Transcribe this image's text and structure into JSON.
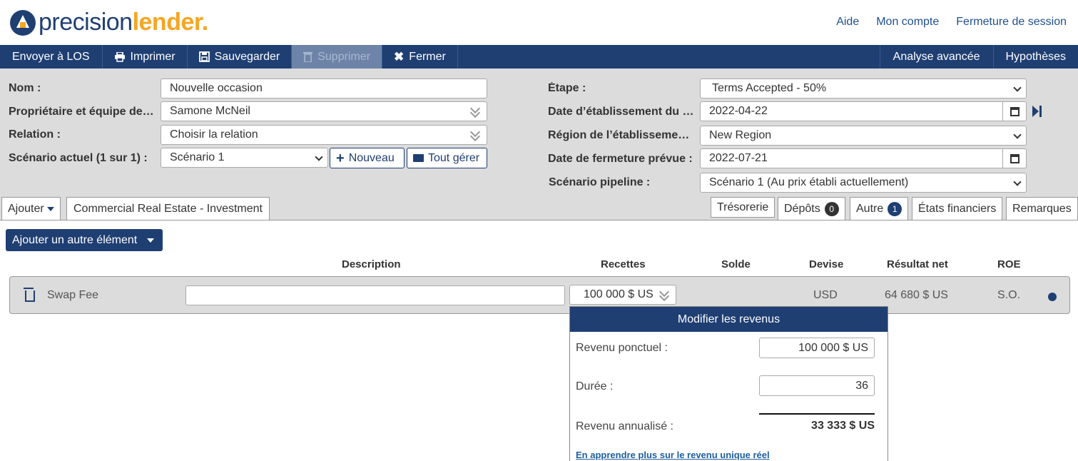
{
  "header": {
    "logo_part1": "precision",
    "logo_part2": "lender",
    "logo_dot": ".",
    "links": [
      "Aide",
      "Mon compte",
      "Fermeture de session"
    ]
  },
  "toolbar": {
    "send_los": "Envoyer à LOS",
    "print": "Imprimer",
    "save": "Sauvegarder",
    "delete": "Supprimer",
    "close": "Fermer",
    "advanced": "Analyse avancée",
    "assumptions": "Hypothèses"
  },
  "form": {
    "name_label": "Nom :",
    "name_value": "Nouvelle occasion",
    "owner_label": "Propriétaire et équipe de…",
    "owner_value": "Samone McNeil",
    "relation_label": "Relation :",
    "relation_value": "Choisir la relation",
    "scenario_label": "Scénario actuel (1 sur 1) :",
    "scenario_value": "Scénario 1",
    "new_btn": "Nouveau",
    "manage_btn": "Tout gérer",
    "stage_label": "Étape :",
    "stage_value": "Terms Accepted - 50%",
    "origination_date_label": "Date d’établissement du …",
    "origination_date_value": "2022-04-22",
    "region_label": "Région de l’établissemen…",
    "region_value": "New Region",
    "close_date_label": "Date de fermeture prévue :",
    "close_date_value": "2022-07-21",
    "pipeline_label": "Scénario pipeline :",
    "pipeline_value": "Scénario 1 (Au prix établi actuellement)"
  },
  "tabs": {
    "add": "Ajouter",
    "product": "Commercial Real Estate - Investment",
    "treasury": "Trésorerie",
    "deposits": "Dépôts",
    "deposits_count": "0",
    "other": "Autre",
    "other_count": "1",
    "financials": "États financiers",
    "notes": "Remarques"
  },
  "content": {
    "add_other_btn": "Ajouter un autre élément",
    "columns": [
      "Description",
      "Recettes",
      "Solde",
      "Devise",
      "Résultat net",
      "ROE"
    ],
    "row": {
      "name": "Swap Fee",
      "description": "",
      "revenue": "100 000 $ US",
      "currency": "USD",
      "net_result": "64 680 $ US",
      "roe": "S.O."
    }
  },
  "popup": {
    "title": "Modifier les revenus",
    "one_time_label": "Revenu ponctuel :",
    "one_time_value": "100 000 $ US",
    "term_label": "Durée :",
    "term_value": "36",
    "annualized_label": "Revenu annualisé :",
    "annualized_value": "33 333 $ US",
    "learn_more": "En apprendre plus sur le revenu unique réel"
  }
}
